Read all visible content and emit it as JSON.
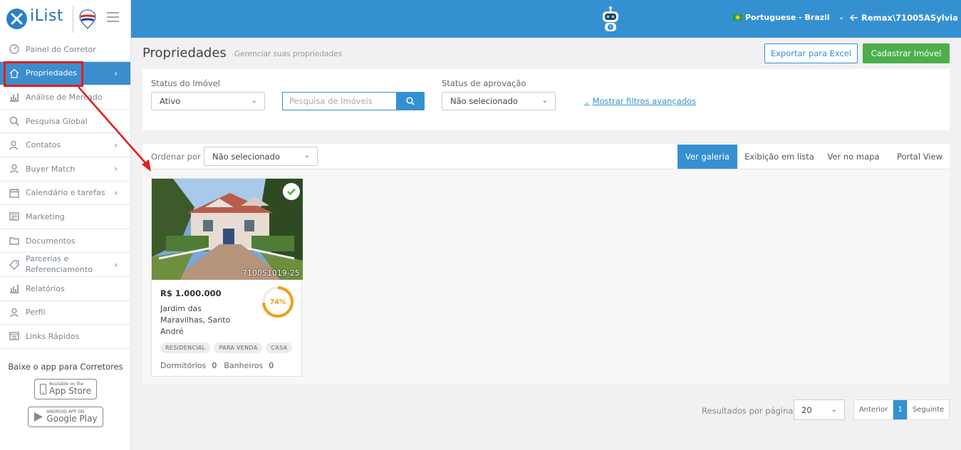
{
  "header": {
    "logo_text": "iList",
    "language": "Portuguese - Brazil",
    "user": "Remax\\71005ASylvia"
  },
  "sidebar": {
    "items": [
      {
        "label": "Painel do Corretor",
        "icon": "gauge-icon",
        "chevron": false
      },
      {
        "label": "Propriedades",
        "icon": "home-icon",
        "chevron": true,
        "active": true
      },
      {
        "label": "Análise de Mercado",
        "icon": "bar-chart-icon",
        "chevron": false
      },
      {
        "label": "Pesquisa Global",
        "icon": "search-icon",
        "chevron": false
      },
      {
        "label": "Contatos",
        "icon": "contacts-icon",
        "chevron": true
      },
      {
        "label": "Buyer Match",
        "icon": "user-icon",
        "chevron": true
      },
      {
        "label": "Calendário e tarefas",
        "icon": "calendar-icon",
        "chevron": true
      },
      {
        "label": "Marketing",
        "icon": "newspaper-icon",
        "chevron": false
      },
      {
        "label": "Documentos",
        "icon": "folder-icon",
        "chevron": false
      },
      {
        "label": "Parcerias e Referenciamento",
        "icon": "tag-icon",
        "chevron": true
      },
      {
        "label": "Relatórios",
        "icon": "bar-chart-icon",
        "chevron": false
      },
      {
        "label": "Perfil",
        "icon": "user-icon",
        "chevron": false
      },
      {
        "label": "Links Rápidos",
        "icon": "links-icon",
        "chevron": false
      }
    ],
    "app_title": "Baixe o app para Corretores",
    "app_store_small": "Available on the",
    "app_store_big": "App Store",
    "google_play_small": "ANDROID APP ON",
    "google_play_big": "Google Play"
  },
  "page": {
    "title": "Propriedades",
    "subtitle": "Gerenciar suas propriedades",
    "export_button": "Exportar para Excel",
    "create_button": "Cadastrar Imóvel"
  },
  "filters": {
    "status_label": "Status do Imóvel",
    "status_value": "Ativo",
    "search_placeholder": "Pesquisa de Imóveis",
    "approval_label": "Status de aprovação",
    "approval_value": "Não selecionado",
    "advanced_link": "Mostrar filtros avançados"
  },
  "results": {
    "order_label": "Ordenar por",
    "order_value": "Não selecionado",
    "views": [
      "Ver galeria",
      "Exibição em lista",
      "Ver no mapa",
      "Portal View"
    ],
    "active_view": "Ver galeria"
  },
  "card": {
    "code": "710051019-25",
    "price": "R$ 1.000.000",
    "address": "Jardim das Maravilhas, Santo André",
    "progress_percent": 74,
    "progress_text": "74%",
    "tags": [
      "RESIDENCIAL",
      "PARA VENDA",
      "CASA"
    ],
    "bedrooms_label": "Dormitórios",
    "bedrooms": "0",
    "bathrooms_label": "Banheiros",
    "bathrooms": "0"
  },
  "pagination": {
    "per_page_label": "Resultados por página",
    "per_page_value": "20",
    "prev": "Anterior",
    "current": "1",
    "next": "Seguinte"
  },
  "colors": {
    "primary": "#3590d2",
    "success": "#4caf4b",
    "progress": "#f39c12",
    "annotation": "#e01e1e"
  }
}
